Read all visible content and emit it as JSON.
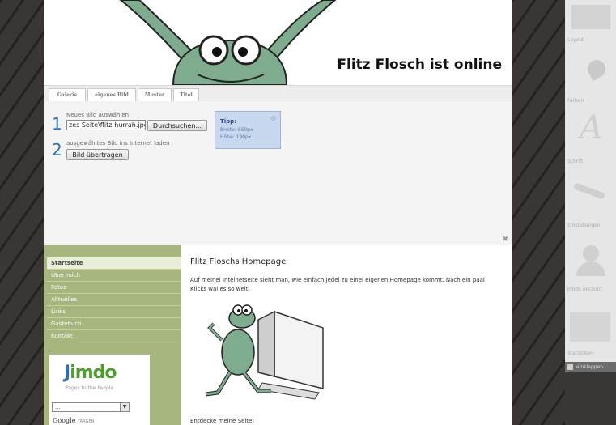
{
  "header": {
    "title": "Flitz Flosch ist online"
  },
  "tabs": [
    {
      "label": "Galerie"
    },
    {
      "label": "eigenes Bild"
    },
    {
      "label": "Muster"
    },
    {
      "label": "Titel"
    }
  ],
  "editor": {
    "step1_number": "1",
    "step1_label": "Neues Bild auswählen",
    "file_input_value": "zes Seite\\flitz-hurrah.jpg",
    "browse_button": "Durchsuchen...",
    "step2_number": "2",
    "step2_label": "ausgewähltes Bild ins Internet laden",
    "upload_button": "Bild übertragen",
    "tip": {
      "title": "Tipp:",
      "line1": "Breite: 850px",
      "line2": "Höhe: 190px"
    }
  },
  "nav": [
    {
      "label": "Startseite"
    },
    {
      "label": "Über mich"
    },
    {
      "label": "Fotos"
    },
    {
      "label": "Aktuelles"
    },
    {
      "label": "Links"
    },
    {
      "label": "Gästebuch"
    },
    {
      "label": "Kontakt"
    }
  ],
  "jimdo": {
    "logo_first": "J",
    "logo_rest": "imdo",
    "tagline": "Pages to the People",
    "select_value": "...",
    "google_label": "Google",
    "google_suffix": "TARGEN"
  },
  "content": {
    "title": "Flitz Floschs Homepage",
    "text": "Auf meinel Intelnetseite sieht man, wie einfach jedel zu einel eigenen Homepage kommt. Nach ein paal Klicks wal es so weit.",
    "footer": "Entdecke meine Seite!"
  },
  "right_panel": [
    {
      "label": "Layout"
    },
    {
      "label": "Farben"
    },
    {
      "label": "Schrift"
    },
    {
      "label": "Einstellungen"
    },
    {
      "label": "Jimdo Account"
    },
    {
      "label": "Statistiken"
    }
  ],
  "collapse_label": "einklappen",
  "colors": {
    "frog_green": "#7fab8f",
    "sidebar_green": "#a6b67e",
    "link_blue": "#2f6fb5",
    "tip_blue": "#c8d8ef"
  }
}
